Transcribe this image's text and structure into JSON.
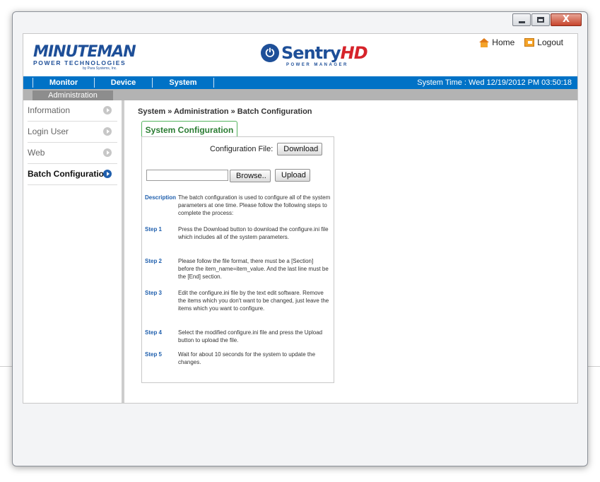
{
  "window": {
    "controls": [
      "minimize-icon",
      "maximize-icon",
      "close-icon"
    ],
    "close_glyph": "X"
  },
  "header": {
    "brand": {
      "name": "MINUTEMAN",
      "sub": "POWER TECHNOLOGIES",
      "sub2": "by Para Systems, Inc."
    },
    "product": {
      "name_main": "Sentry",
      "name_accent": "HD",
      "sub": "POWER MANAGER"
    },
    "links": {
      "home": "Home",
      "logout": "Logout"
    }
  },
  "nav": {
    "items": [
      "Monitor",
      "Device",
      "System"
    ],
    "system_time": "System Time : Wed 12/19/2012 PM 03:50:18"
  },
  "subnav": {
    "active_tab": "Administration"
  },
  "sidebar": {
    "items": [
      {
        "label": "Information",
        "active": false
      },
      {
        "label": "Login User",
        "active": false
      },
      {
        "label": "Web",
        "active": false
      },
      {
        "label": "Batch Configuration",
        "active": true
      }
    ]
  },
  "main": {
    "breadcrumb": "System » Administration » Batch Configuration",
    "tab_title": "System Configuration",
    "config_file_label": "Configuration File:",
    "download_label": "Download",
    "browse_label": "Browse..",
    "upload_label": "Upload",
    "description_label": "Description",
    "description_text": "The batch configuration is used to configure all of the system parameters at one time. Please follow the following steps to complete the process:",
    "steps": [
      {
        "label": "Step 1",
        "text": "Press the Download button to download the configure.ini file which includes all of the system parameters."
      },
      {
        "label": "Step 2",
        "text": "Please follow the file format, there must be a [Section] before the item_name=item_value. And the last line must be the [End] section."
      },
      {
        "label": "Step 3",
        "text": "Edit the configure.ini file by the text edit software. Remove the items which you don't want to be changed, just leave the items which you want to configure."
      },
      {
        "label": "Step 4",
        "text": "Select the modified configure.ini file and press the Upload button to upload the file."
      },
      {
        "label": "Step 5",
        "text": "Wait for about 10 seconds for the system to update the changes."
      }
    ]
  },
  "colors": {
    "nav_blue": "#0072c6",
    "brand_blue": "#1e4f98",
    "accent_red": "#d6232a",
    "tab_green": "#2b7d33"
  }
}
